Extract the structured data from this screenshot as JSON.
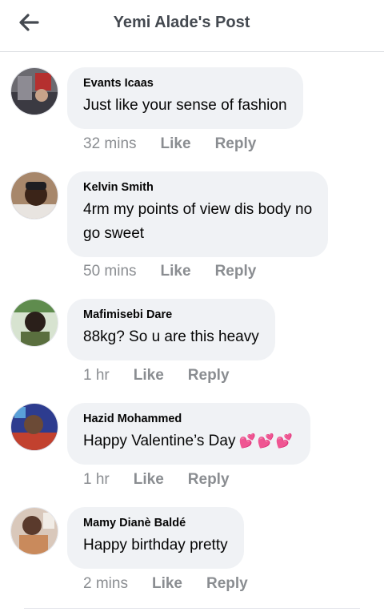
{
  "header": {
    "title": "Yemi Alade's Post"
  },
  "comments": [
    {
      "author": "Evants Icaas",
      "text": "Just like your sense of fashion",
      "time": "32 mins",
      "like": "Like",
      "reply": "Reply"
    },
    {
      "author": "Kelvin Smith",
      "text": "4rm my points of view dis body no\ngo sweet",
      "time": "50 mins",
      "like": "Like",
      "reply": "Reply"
    },
    {
      "author": "Mafimisebi Dare",
      "text": "88kg? So u are this heavy",
      "time": "1 hr",
      "like": "Like",
      "reply": "Reply"
    },
    {
      "author": "Hazid Mohammed",
      "text": "Happy Valentine’s Day",
      "emoji": "💕💕💕",
      "time": "1 hr",
      "like": "Like",
      "reply": "Reply"
    },
    {
      "author": "Mamy Dianè Baldé",
      "text": "Happy birthday pretty",
      "time": "2 mins",
      "like": "Like",
      "reply": "Reply"
    }
  ],
  "colors": {
    "bubble": "#f0f2f5",
    "meta": "#8a8d91",
    "title": "#444950"
  }
}
